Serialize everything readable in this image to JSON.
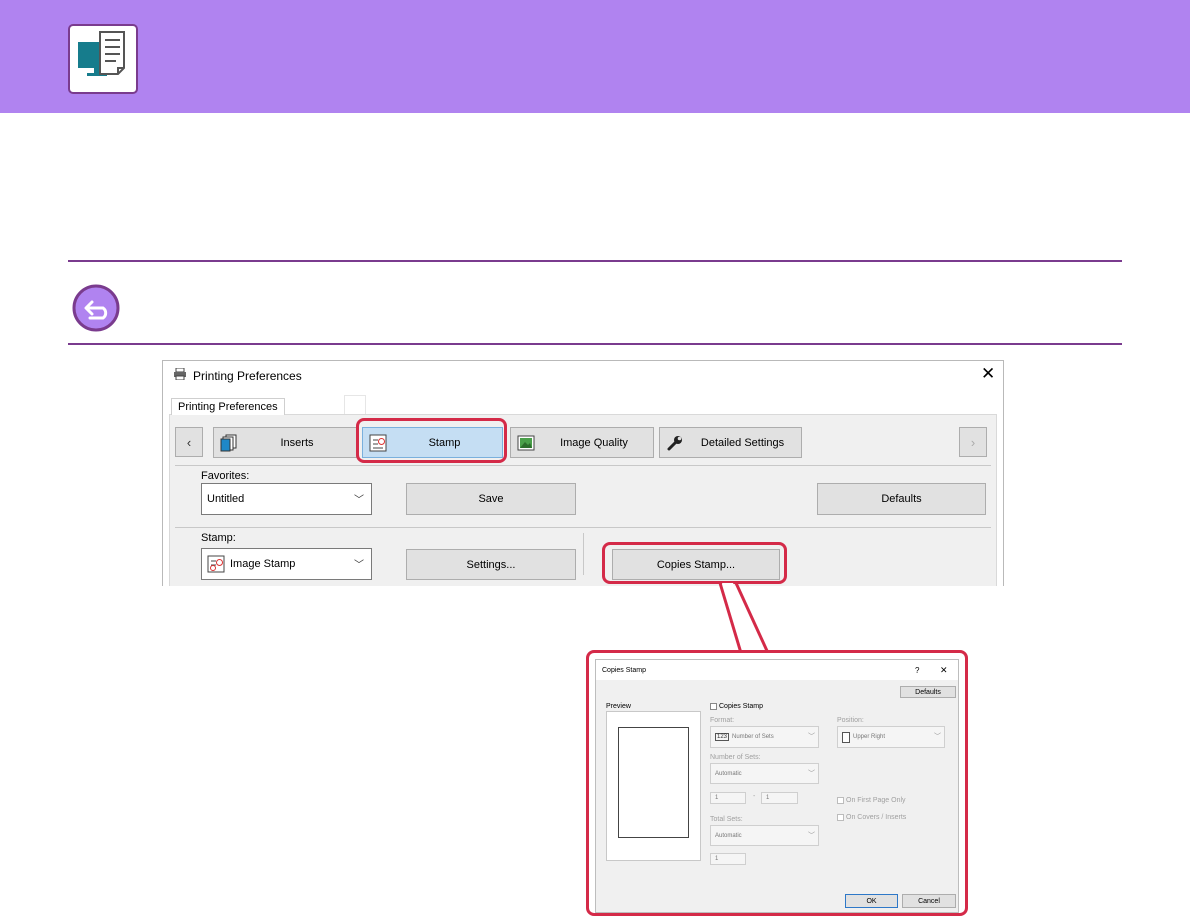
{
  "colors": {
    "banner": "#b083f0",
    "accent": "#7a3b8e",
    "highlight": "#d42a48",
    "selected_tab": "#c5def3"
  },
  "main_dialog": {
    "title": "Printing Preferences",
    "close_glyph": "✕",
    "tab_label": "Printing Preferences",
    "nav_prev": "‹",
    "nav_next": "›",
    "ribbon": [
      {
        "label": "Inserts",
        "icon": "inserts-icon"
      },
      {
        "label": "Stamp",
        "icon": "stamp-icon",
        "selected": true
      },
      {
        "label": "Image Quality",
        "icon": "image-quality-icon"
      },
      {
        "label": "Detailed Settings",
        "icon": "wrench-icon"
      }
    ],
    "favorites": {
      "label": "Favorites:",
      "value": "Untitled",
      "save": "Save",
      "defaults": "Defaults"
    },
    "stamp": {
      "label": "Stamp:",
      "value": "Image Stamp",
      "settings": "Settings...",
      "copies_stamp": "Copies Stamp..."
    }
  },
  "copies_stamp_dialog": {
    "title": "Copies Stamp",
    "help": "?",
    "close": "✕",
    "defaults": "Defaults",
    "preview_label": "Preview",
    "checkbox_label": "Copies Stamp",
    "format_label": "Format:",
    "format_value": "Number of Sets",
    "format_badge": "123",
    "position_label": "Position:",
    "position_value": "Upper Right",
    "number_of_sets_label": "Number of Sets:",
    "number_of_sets_value": "Automatic",
    "range_from": "1",
    "range_dash": "-",
    "range_to": "1",
    "on_first_page_only": "On First Page Only",
    "on_covers_inserts": "On Covers / Inserts",
    "total_sets_label": "Total Sets:",
    "total_sets_value": "Automatic",
    "total_sets_number": "1",
    "ok": "OK",
    "cancel": "Cancel"
  }
}
